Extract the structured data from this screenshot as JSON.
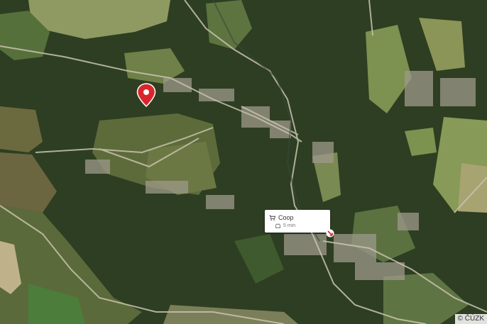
{
  "map": {
    "imagery": "aerial",
    "attribution": "© ČÚZK"
  },
  "location_pin": {
    "icon": "map-pin-icon",
    "color": "#d9262c"
  },
  "route_popup": {
    "place_name": "Coop",
    "place_icon": "shopping-cart-icon",
    "travel_time": "5 min",
    "travel_mode_icon": "car-icon"
  },
  "destination_marker": {
    "icon": "destination-arrow-icon",
    "color": "#d9262c"
  }
}
